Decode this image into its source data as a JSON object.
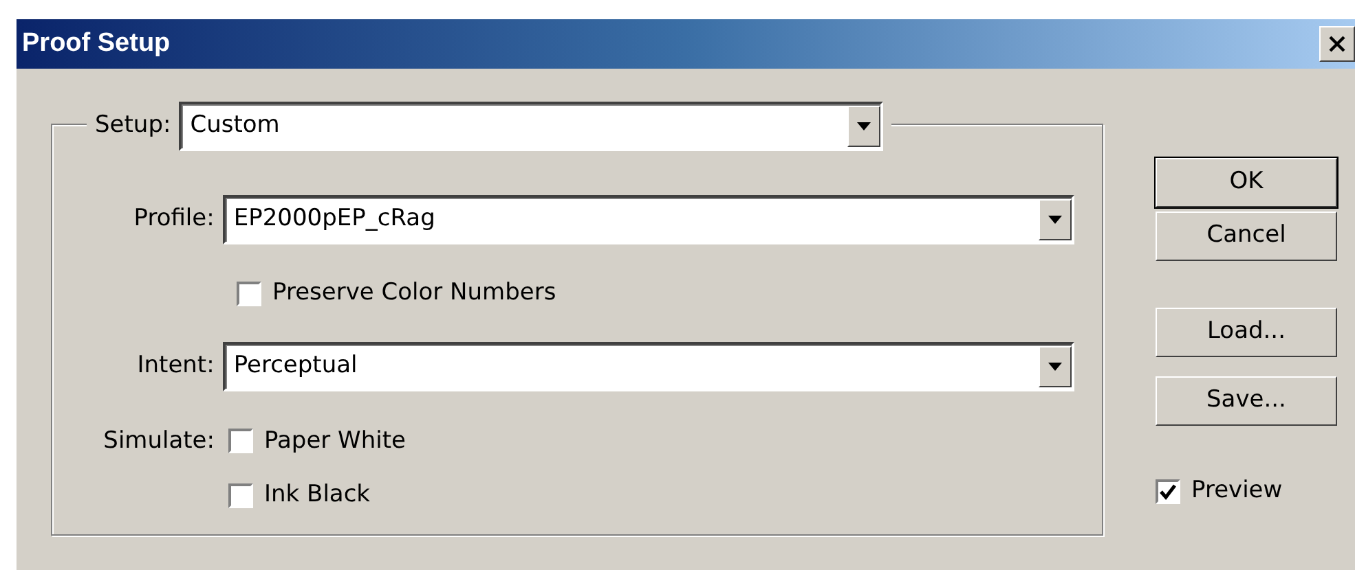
{
  "window": {
    "title": "Proof Setup"
  },
  "setup": {
    "label": "Setup:",
    "value": "Custom"
  },
  "profile": {
    "label": "Profile:",
    "value": "EP2000pEP_cRag"
  },
  "preserve_color_numbers": {
    "label": "Preserve Color Numbers",
    "checked": false
  },
  "intent": {
    "label": "Intent:",
    "value": "Perceptual"
  },
  "simulate": {
    "label": "Simulate:",
    "options": [
      {
        "label": "Paper White",
        "checked": false
      },
      {
        "label": "Ink Black",
        "checked": false
      }
    ]
  },
  "buttons": [
    {
      "label": "OK",
      "default": true
    },
    {
      "label": "Cancel",
      "default": false
    },
    {
      "label": "Load...",
      "default": false
    },
    {
      "label": "Save...",
      "default": false
    }
  ],
  "preview": {
    "label": "Preview",
    "checked": true
  }
}
